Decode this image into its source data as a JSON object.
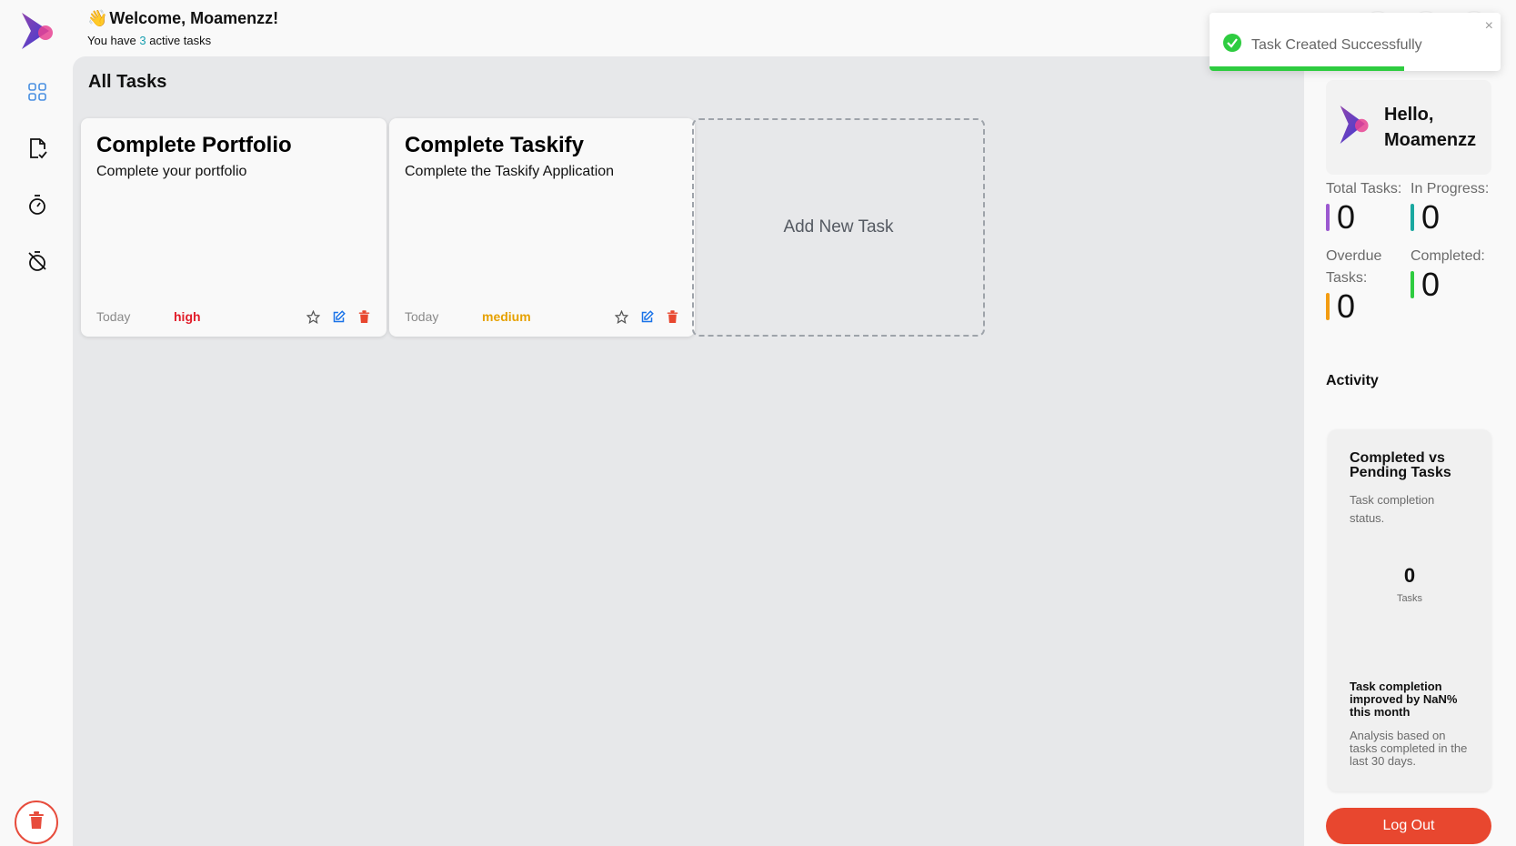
{
  "header": {
    "wave": "👋",
    "welcome": "Welcome, Moamenzz!",
    "subtitle_prefix": "You have",
    "active_count": "3",
    "subtitle_suffix": "active tasks"
  },
  "main": {
    "title": "All Tasks",
    "add_task_label": "Add New Task",
    "tasks": [
      {
        "title": "Complete Portfolio",
        "description": "Complete your portfolio",
        "date": "Today",
        "priority": "high"
      },
      {
        "title": "Complete Taskify",
        "description": "Complete the Taskify Application",
        "date": "Today",
        "priority": "medium"
      }
    ]
  },
  "profile": {
    "greeting": "Hello,",
    "name": "Moamenzz"
  },
  "stats": {
    "total_label": "Total Tasks:",
    "total_value": "0",
    "progress_label": "In Progress:",
    "progress_value": "0",
    "overdue_label_1": "Overdue",
    "overdue_label_2": "Tasks:",
    "overdue_value": "0",
    "completed_label": "Completed:",
    "completed_value": "0"
  },
  "activity": {
    "title": "Activity",
    "card_title": "Completed vs Pending Tasks",
    "card_desc": "Task completion status.",
    "count": "0",
    "count_label": "Tasks",
    "trend": "Task completion improved by NaN% this month",
    "note": "Analysis based on tasks completed in the last 30 days."
  },
  "logout_label": "Log Out",
  "toast": {
    "message": "Task Created Successfully",
    "close": "×",
    "progress": 0.67
  },
  "colors": {
    "accent": "#1a9fb0",
    "high": "#e11d2a",
    "medium": "#e6a100",
    "danger": "#e8472f",
    "total_bar": "#9b59d0",
    "progress_bar": "#1aa8a0",
    "overdue_bar": "#f39c12",
    "completed_bar": "#2ecc40",
    "success": "#2ecc40"
  },
  "icons": {
    "nav": [
      "grid-icon",
      "file-check-icon",
      "timer-icon",
      "timer-off-icon"
    ],
    "task_actions": [
      "star-icon",
      "edit-icon",
      "trash-icon"
    ]
  }
}
